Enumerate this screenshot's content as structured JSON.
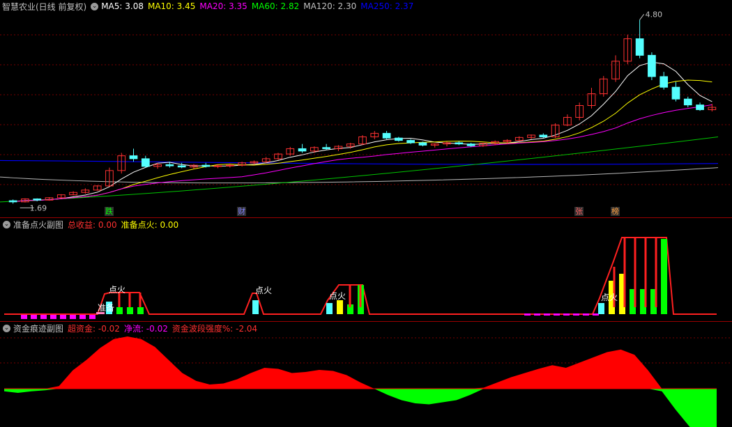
{
  "main": {
    "title": "智慧农业(日线 前复权)",
    "ma": [
      {
        "label": "MA5: 3.08",
        "color": "#ffffff"
      },
      {
        "label": "MA10: 3.45",
        "color": "#ffff00"
      },
      {
        "label": "MA20: 3.35",
        "color": "#ff00ff"
      },
      {
        "label": "MA60: 2.82",
        "color": "#00ff00"
      },
      {
        "label": "MA120: 2.30",
        "color": "#c0c0c0"
      },
      {
        "label": "MA250: 2.37",
        "color": "#0000ff"
      }
    ],
    "high_label": "4.80",
    "low_label": "1.69",
    "markers": [
      {
        "text": "跌",
        "color": "#00ff00",
        "bg": "#303030"
      },
      {
        "text": "财",
        "color": "#8080ff",
        "bg": "#303030"
      },
      {
        "text": "张",
        "color": "#ff6060",
        "bg": "#303030"
      },
      {
        "text": "榜",
        "color": "#ffa040",
        "bg": "#303030"
      }
    ]
  },
  "sub1": {
    "title": "准备点火副图",
    "items": [
      {
        "label": "总收益: 0.00",
        "color": "#ff3030"
      },
      {
        "label": "准备点火: 0.00",
        "color": "#ffff00"
      }
    ],
    "annotations": [
      "点火",
      "点火",
      "点火",
      "点火",
      "准备"
    ]
  },
  "sub2": {
    "title": "资金痕迹副图",
    "items": [
      {
        "label": "超资金: -0.02",
        "color": "#ff3030"
      },
      {
        "label": "净流: -0.02",
        "color": "#ff00ff"
      },
      {
        "label": "资金波段强度%: -2.04",
        "color": "#ff3030"
      }
    ]
  },
  "colors": {
    "up": "#ff3232",
    "down": "#54ffff",
    "grid": "#7a0000"
  },
  "chart_data": [
    {
      "type": "candlestick",
      "title": "智慧农业(日线 前复权)",
      "y_range": [
        1.6,
        4.9
      ],
      "ohlc": [
        [
          1.74,
          1.76,
          1.69,
          1.72
        ],
        [
          1.72,
          1.78,
          1.71,
          1.77
        ],
        [
          1.77,
          1.78,
          1.73,
          1.75
        ],
        [
          1.75,
          1.8,
          1.74,
          1.79
        ],
        [
          1.79,
          1.85,
          1.78,
          1.84
        ],
        [
          1.84,
          1.9,
          1.83,
          1.88
        ],
        [
          1.88,
          1.95,
          1.86,
          1.92
        ],
        [
          1.92,
          2.0,
          1.91,
          1.99
        ],
        [
          1.99,
          2.3,
          1.98,
          2.25
        ],
        [
          2.25,
          2.55,
          2.2,
          2.5
        ],
        [
          2.5,
          2.62,
          2.4,
          2.45
        ],
        [
          2.45,
          2.5,
          2.3,
          2.32
        ],
        [
          2.32,
          2.38,
          2.28,
          2.35
        ],
        [
          2.35,
          2.4,
          2.3,
          2.33
        ],
        [
          2.33,
          2.38,
          2.29,
          2.31
        ],
        [
          2.31,
          2.36,
          2.28,
          2.34
        ],
        [
          2.34,
          2.38,
          2.3,
          2.32
        ],
        [
          2.32,
          2.36,
          2.29,
          2.33
        ],
        [
          2.33,
          2.37,
          2.3,
          2.34
        ],
        [
          2.34,
          2.4,
          2.32,
          2.38
        ],
        [
          2.38,
          2.42,
          2.35,
          2.4
        ],
        [
          2.4,
          2.48,
          2.38,
          2.45
        ],
        [
          2.45,
          2.55,
          2.43,
          2.53
        ],
        [
          2.53,
          2.65,
          2.5,
          2.62
        ],
        [
          2.62,
          2.7,
          2.55,
          2.58
        ],
        [
          2.58,
          2.66,
          2.55,
          2.64
        ],
        [
          2.64,
          2.7,
          2.6,
          2.62
        ],
        [
          2.62,
          2.68,
          2.58,
          2.66
        ],
        [
          2.66,
          2.72,
          2.62,
          2.7
        ],
        [
          2.7,
          2.85,
          2.68,
          2.82
        ],
        [
          2.82,
          2.92,
          2.78,
          2.88
        ],
        [
          2.88,
          2.92,
          2.78,
          2.8
        ],
        [
          2.8,
          2.82,
          2.74,
          2.76
        ],
        [
          2.76,
          2.78,
          2.7,
          2.72
        ],
        [
          2.72,
          2.74,
          2.66,
          2.68
        ],
        [
          2.68,
          2.71,
          2.64,
          2.7
        ],
        [
          2.7,
          2.74,
          2.66,
          2.72
        ],
        [
          2.72,
          2.75,
          2.68,
          2.7
        ],
        [
          2.7,
          2.72,
          2.65,
          2.67
        ],
        [
          2.67,
          2.72,
          2.65,
          2.71
        ],
        [
          2.71,
          2.76,
          2.68,
          2.74
        ],
        [
          2.74,
          2.78,
          2.7,
          2.76
        ],
        [
          2.76,
          2.83,
          2.74,
          2.81
        ],
        [
          2.81,
          2.86,
          2.78,
          2.85
        ],
        [
          2.85,
          2.88,
          2.8,
          2.82
        ],
        [
          2.82,
          3.05,
          2.8,
          3.02
        ],
        [
          3.02,
          3.2,
          3.0,
          3.15
        ],
        [
          3.15,
          3.4,
          3.1,
          3.35
        ],
        [
          3.35,
          3.65,
          3.3,
          3.55
        ],
        [
          3.55,
          3.85,
          3.5,
          3.8
        ],
        [
          3.8,
          4.2,
          3.75,
          4.1
        ],
        [
          4.1,
          4.55,
          4.05,
          4.48
        ],
        [
          4.48,
          4.8,
          4.15,
          4.2
        ],
        [
          4.2,
          4.25,
          3.78,
          3.84
        ],
        [
          3.84,
          3.92,
          3.62,
          3.66
        ],
        [
          3.66,
          3.75,
          3.42,
          3.46
        ],
        [
          3.46,
          3.5,
          3.32,
          3.36
        ],
        [
          3.36,
          3.4,
          3.26,
          3.28
        ],
        [
          3.28,
          3.38,
          3.25,
          3.32
        ]
      ]
    },
    {
      "type": "bar",
      "title": "准备点火副图",
      "series_name": "准备点火",
      "y_range": [
        0,
        10
      ]
    },
    {
      "type": "area",
      "title": "资金痕迹副图",
      "y_range": [
        -1,
        1
      ],
      "values": [
        -0.05,
        -0.08,
        -0.05,
        -0.03,
        0.05,
        0.35,
        0.55,
        0.78,
        0.95,
        1.0,
        0.95,
        0.8,
        0.55,
        0.3,
        0.15,
        0.08,
        0.1,
        0.18,
        0.3,
        0.4,
        0.38,
        0.3,
        0.32,
        0.36,
        0.34,
        0.26,
        0.12,
        0.0,
        -0.12,
        -0.22,
        -0.28,
        -0.3,
        -0.26,
        -0.22,
        -0.12,
        0.02,
        0.12,
        0.22,
        0.3,
        0.38,
        0.45,
        0.4,
        0.5,
        0.6,
        0.7,
        0.75,
        0.65,
        0.35,
        -0.05,
        -0.4,
        -0.72,
        -0.98,
        -0.85
      ]
    }
  ]
}
